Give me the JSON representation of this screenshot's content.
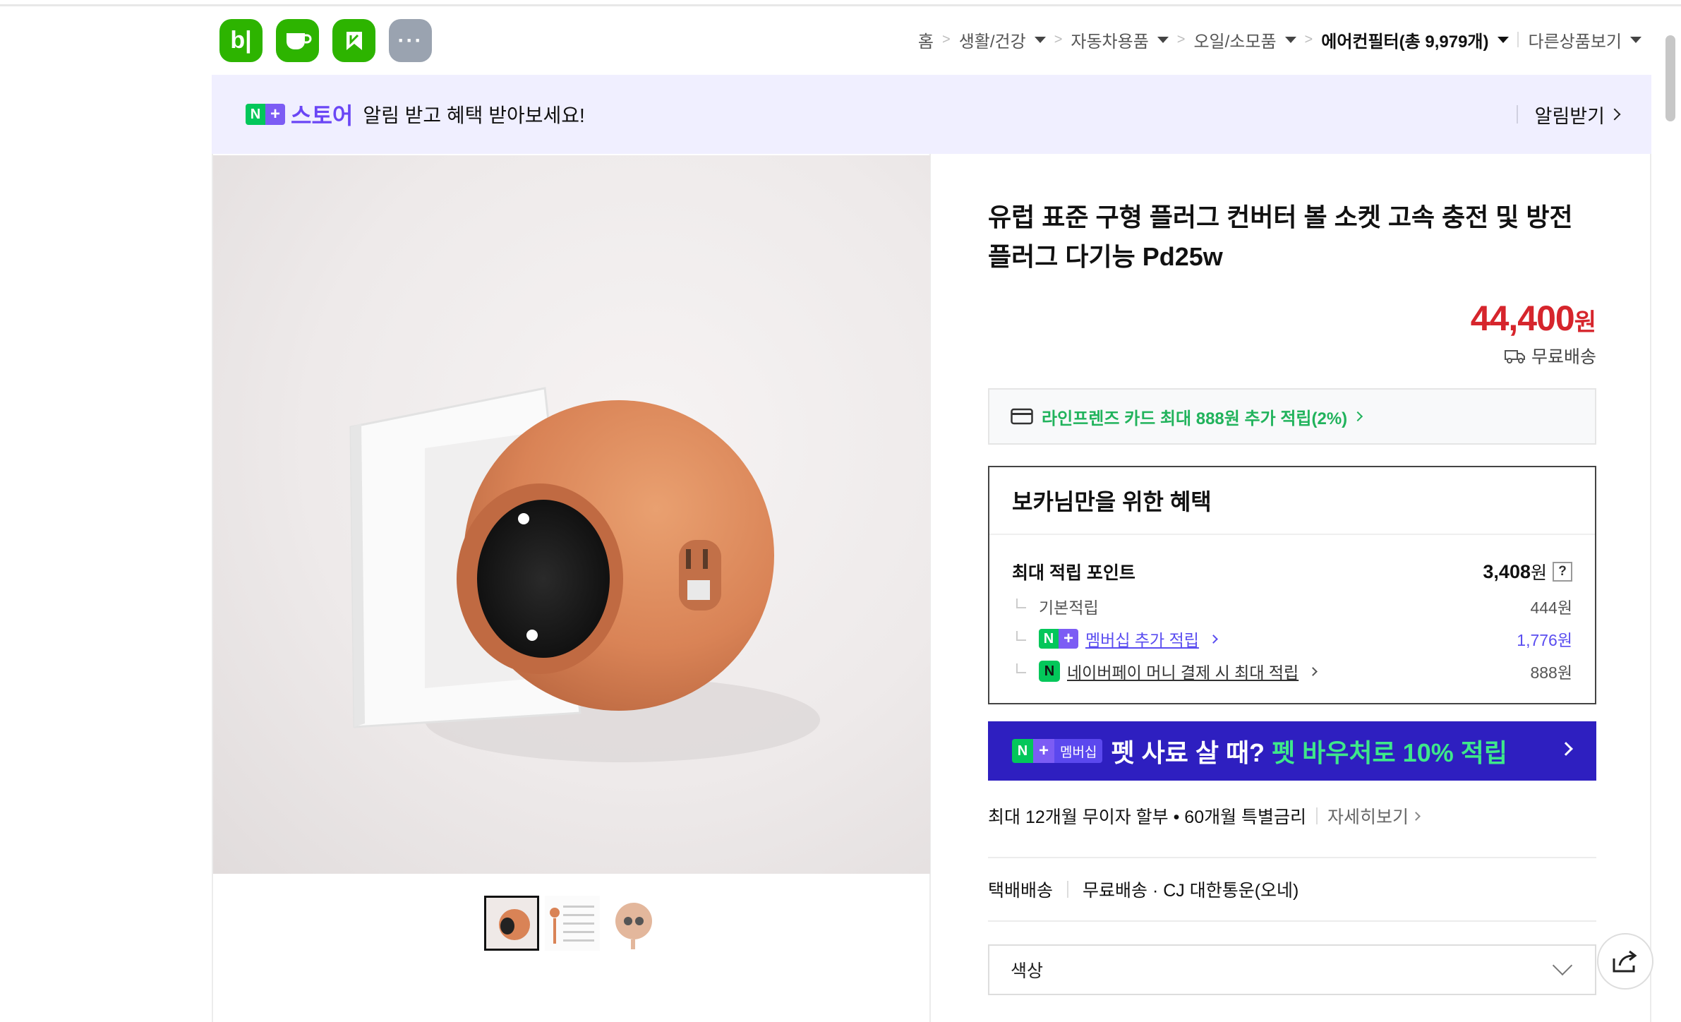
{
  "header": {
    "apps": [
      {
        "name": "blog",
        "label": "b|"
      },
      {
        "name": "cafe",
        "label": ""
      },
      {
        "name": "kin",
        "label": ""
      },
      {
        "name": "more",
        "label": "···"
      }
    ],
    "breadcrumb": {
      "home": "홈",
      "items": [
        "생활/건강",
        "자동차용품",
        "오일/소모품",
        "에어컨필터(총 9,979개)"
      ],
      "other": "다른상품보기"
    }
  },
  "store_banner": {
    "badge_n": "N",
    "badge_plus": "+",
    "store_word": "스토어",
    "message": "알림 받고 혜택 받아보세요!",
    "alarm_label": "알림받기"
  },
  "product": {
    "title": "유럽 표준 구형 플러그 컨버터 볼 소켓 고속 충전 및 방전 플러그 다기능 Pd25w",
    "price": "44,400",
    "currency": "원",
    "shipping": "무료배송",
    "card_offer": "라인프렌즈 카드 최대 888원 추가 적립(2%)"
  },
  "benefit": {
    "heading": "보카님만을 위한 혜택",
    "max_points_label": "최대 적립 포인트",
    "max_points_value": "3,408",
    "max_points_unit": "원",
    "help": "?",
    "rows": [
      {
        "label": "기본적립",
        "value": "444원"
      },
      {
        "label": "멤버십 추가 적립",
        "value": "1,776원"
      },
      {
        "label": "네이버페이 머니 결제 시 최대 적립",
        "value": "888원"
      }
    ]
  },
  "promo": {
    "tag_n": "N",
    "tag_plus": "+",
    "tag_member": "멤버십",
    "text_white": "펫 사료 살 때?",
    "text_green": "펫 바우처로 10% 적립"
  },
  "installment": {
    "text": "최대 12개월 무이자 할부 • 60개월 특별금리",
    "detail": "자세히보기"
  },
  "delivery": {
    "type": "택배배송",
    "detail": "무료배송 · CJ 대한통운(오네)"
  },
  "option": {
    "placeholder": "색상"
  },
  "colors": {
    "price": "#d6252c",
    "naver_green": "#03c75a",
    "store_purple": "#6a46f5",
    "promo_bg": "#2e1fc0",
    "product_orange": "#d98356"
  }
}
